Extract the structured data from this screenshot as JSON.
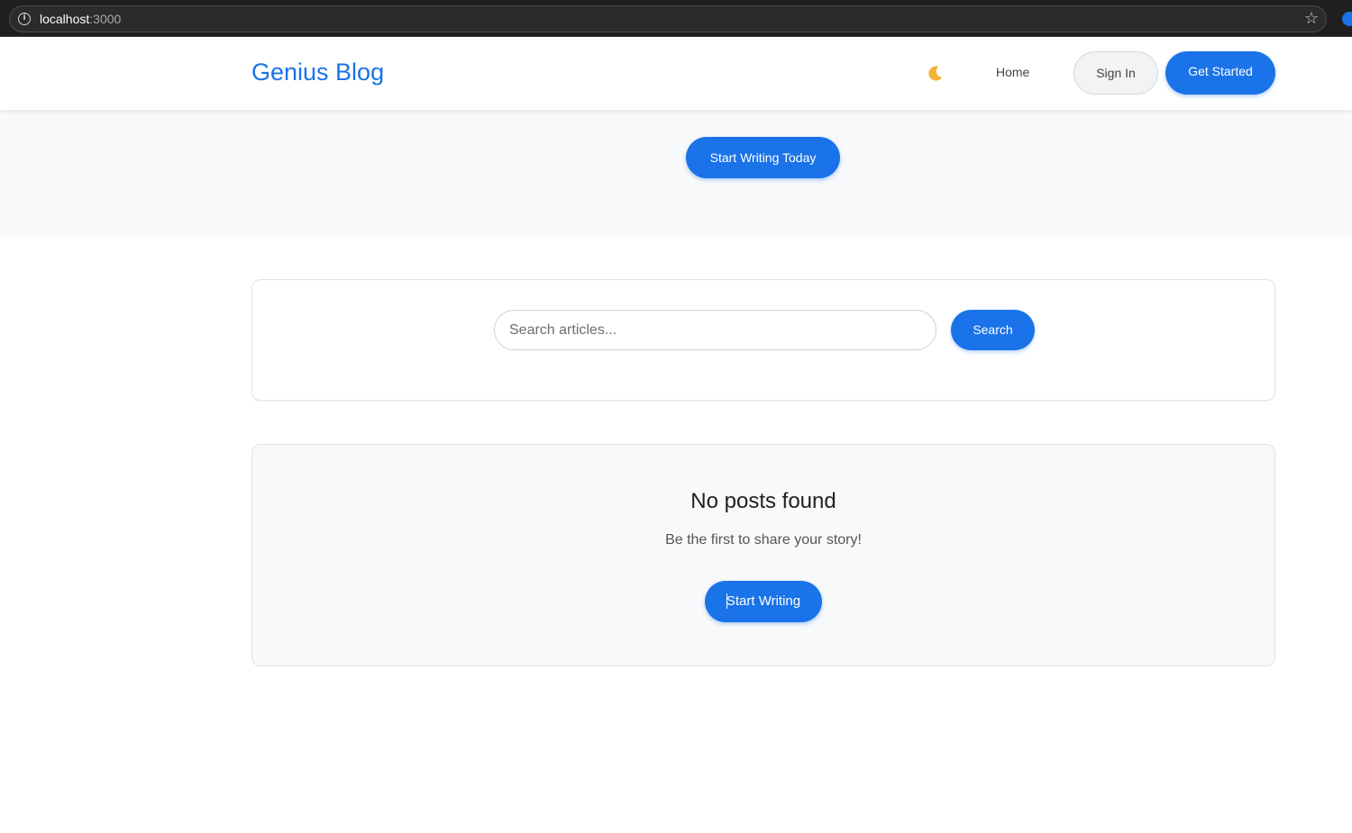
{
  "browser": {
    "url_host": "localhost",
    "url_port": ":3000"
  },
  "header": {
    "brand": "Genius Blog",
    "theme_toggle_icon": "moon-icon",
    "nav_home": "Home",
    "sign_in": "Sign In",
    "get_started": "Get Started"
  },
  "hero": {
    "cta": "Start Writing Today"
  },
  "search": {
    "placeholder": "Search articles...",
    "value": "",
    "button": "Search"
  },
  "empty_state": {
    "title": "No posts found",
    "subtitle": "Be the first to share your story!",
    "button": "Start Writing"
  },
  "colors": {
    "accent": "#1a73e8",
    "hero_bg": "#f8f9fa"
  }
}
